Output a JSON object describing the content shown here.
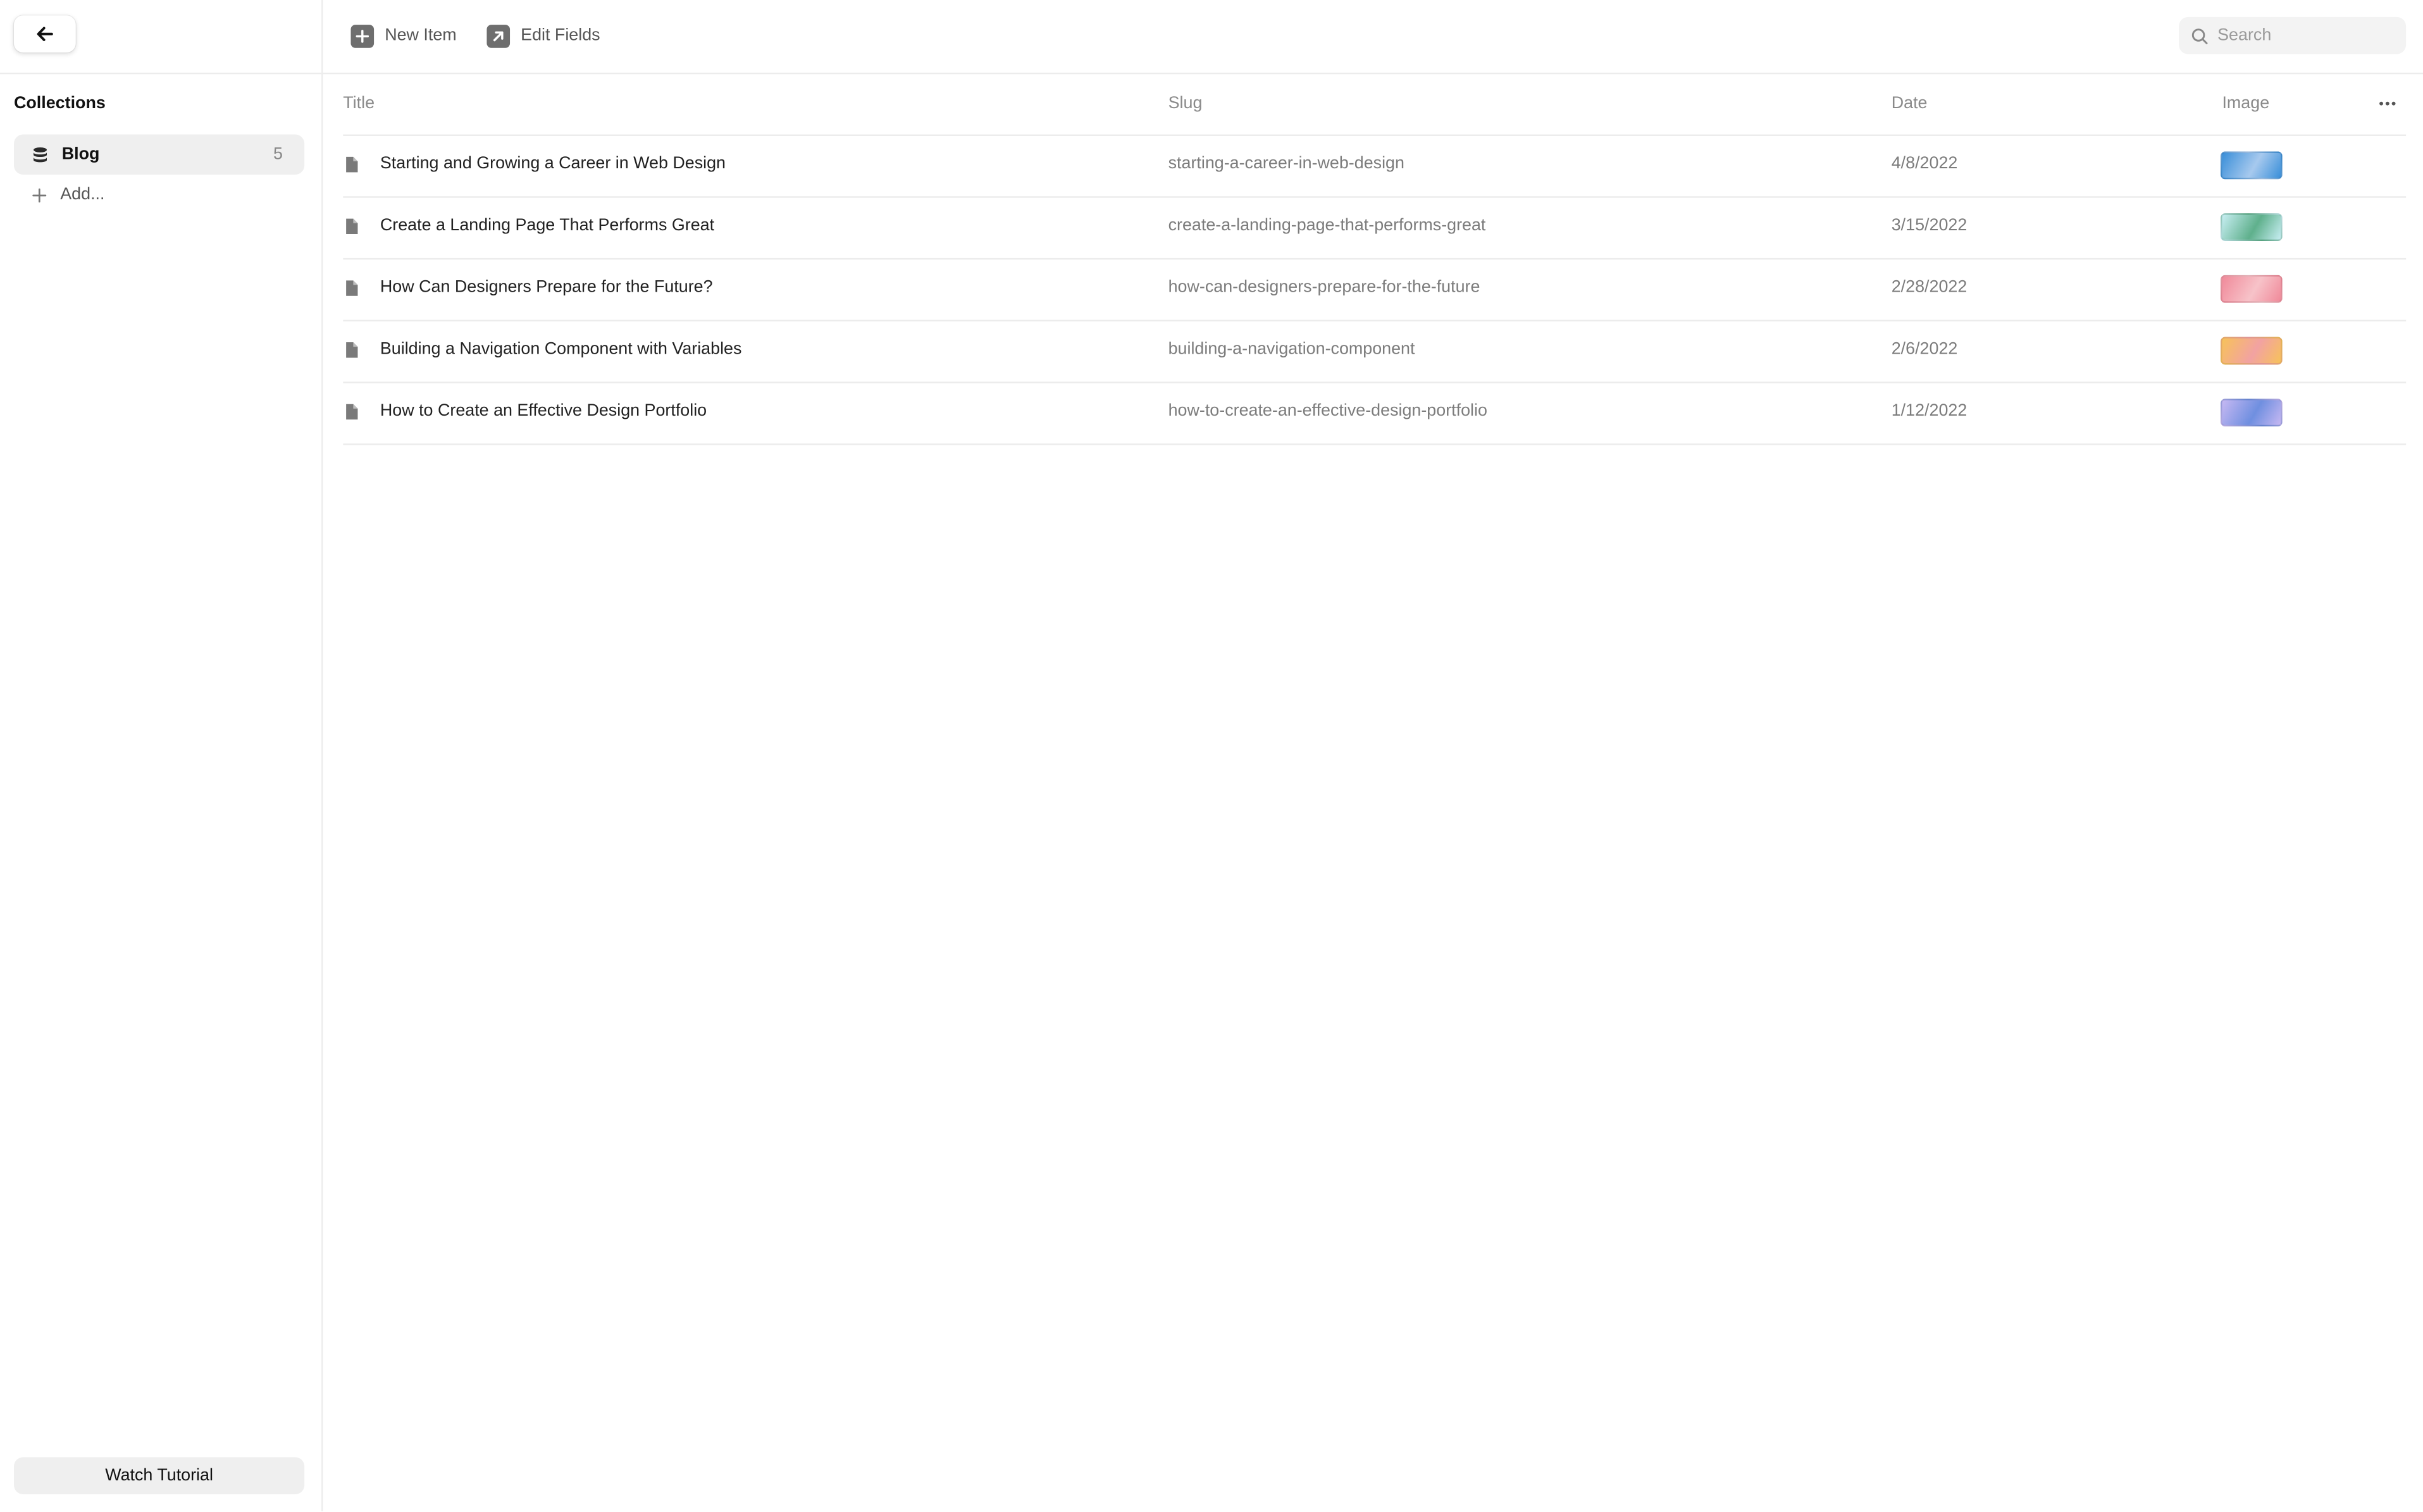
{
  "sidebar": {
    "collections_heading": "Collections",
    "collections": [
      {
        "label": "Blog",
        "count": "5",
        "icon": "database-icon"
      }
    ],
    "add_label": "Add...",
    "watch_tutorial_label": "Watch Tutorial"
  },
  "toolbar": {
    "new_item_label": "New Item",
    "edit_fields_label": "Edit Fields",
    "search_placeholder": "Search",
    "search_value": ""
  },
  "table": {
    "columns": {
      "title": "Title",
      "slug": "Slug",
      "date": "Date",
      "image": "Image"
    },
    "rows": [
      {
        "title": "Starting and Growing a Career in Web Design",
        "slug": "starting-a-career-in-web-design",
        "date": "4/8/2022",
        "image_colors": [
          "#3a8fd9",
          "#a7c9ee"
        ]
      },
      {
        "title": "Create a Landing Page That Performs Great",
        "slug": "create-a-landing-page-that-performs-great",
        "date": "3/15/2022",
        "image_colors": [
          "#c7eef2",
          "#5fb08c"
        ]
      },
      {
        "title": "How Can Designers Prepare for the Future?",
        "slug": "how-can-designers-prepare-for-the-future",
        "date": "2/28/2022",
        "image_colors": [
          "#f08a9a",
          "#f7c3c9"
        ]
      },
      {
        "title": "Building a Navigation Component with Variables",
        "slug": "building-a-navigation-component",
        "date": "2/6/2022",
        "image_colors": [
          "#f7c25a",
          "#f2a2a2"
        ]
      },
      {
        "title": "How to Create an Effective Design Portfolio",
        "slug": "how-to-create-an-effective-design-portfolio",
        "date": "1/12/2022",
        "image_colors": [
          "#c6b8f2",
          "#6f8fe0"
        ]
      }
    ]
  }
}
